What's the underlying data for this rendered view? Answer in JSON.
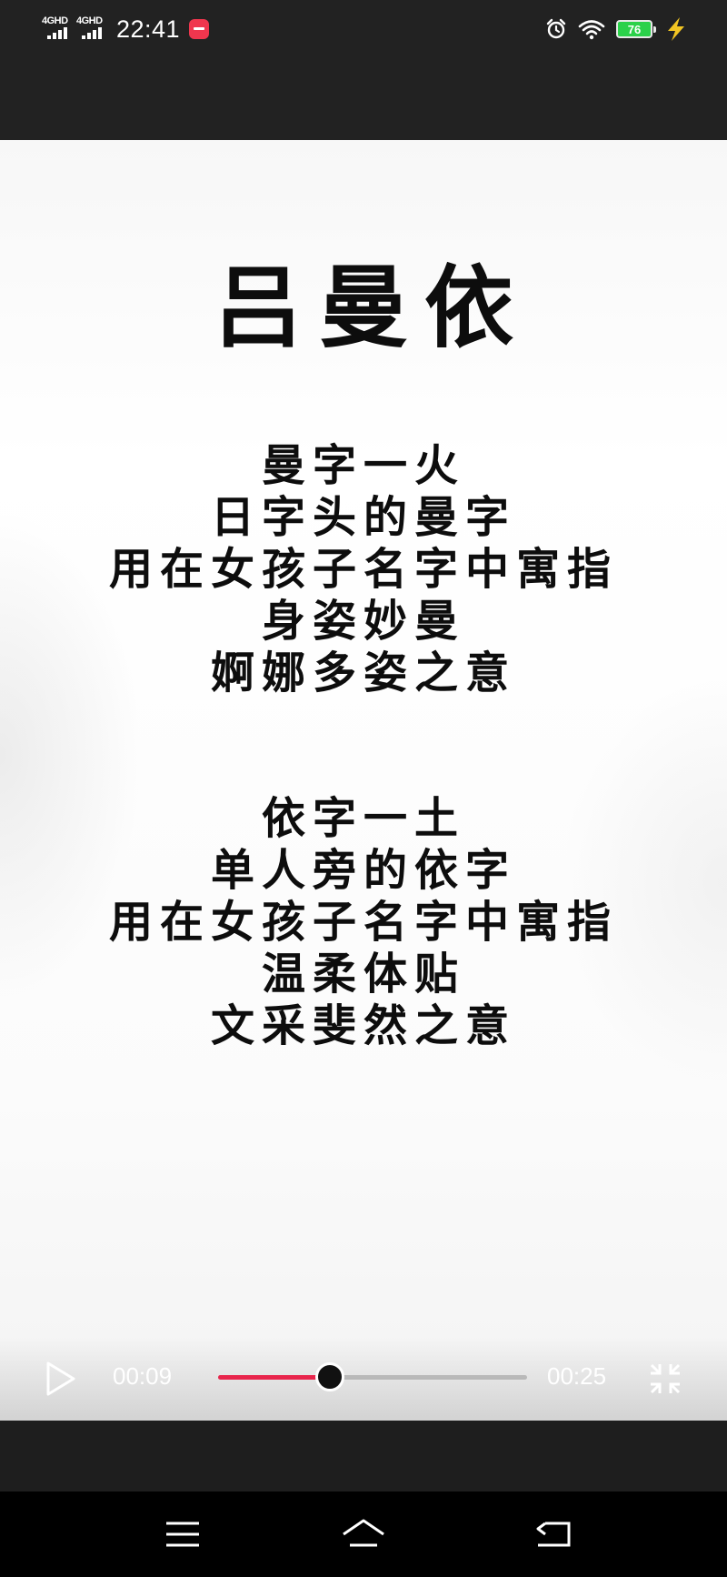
{
  "status_bar": {
    "network_1": "4GHD",
    "network_2": "4GHD",
    "time": "22:41",
    "icons": [
      "signal-icon",
      "signal-icon",
      "app-notification-icon",
      "alarm-icon",
      "wifi-icon",
      "battery-icon",
      "charging-bolt-icon"
    ],
    "battery_level": "76",
    "battery_color": "#2bd14a"
  },
  "video": {
    "title": "吕曼依",
    "verse_1": [
      "曼字一火",
      "日字头的曼字",
      "用在女孩子名字中寓指",
      "身姿妙曼",
      "婀娜多姿之意"
    ],
    "verse_2": [
      "依字一土",
      "单人旁的依字",
      "用在女孩子名字中寓指",
      "温柔体贴",
      "文采斐然之意"
    ]
  },
  "player": {
    "current_time": "00:09",
    "total_time": "00:25",
    "progress": 0.36,
    "accent_color": "#e8254c",
    "icons": [
      "play-icon",
      "exit-fullscreen-icon"
    ]
  },
  "nav_bar": {
    "icons": [
      "menu-icon",
      "home-icon",
      "back-icon"
    ]
  }
}
